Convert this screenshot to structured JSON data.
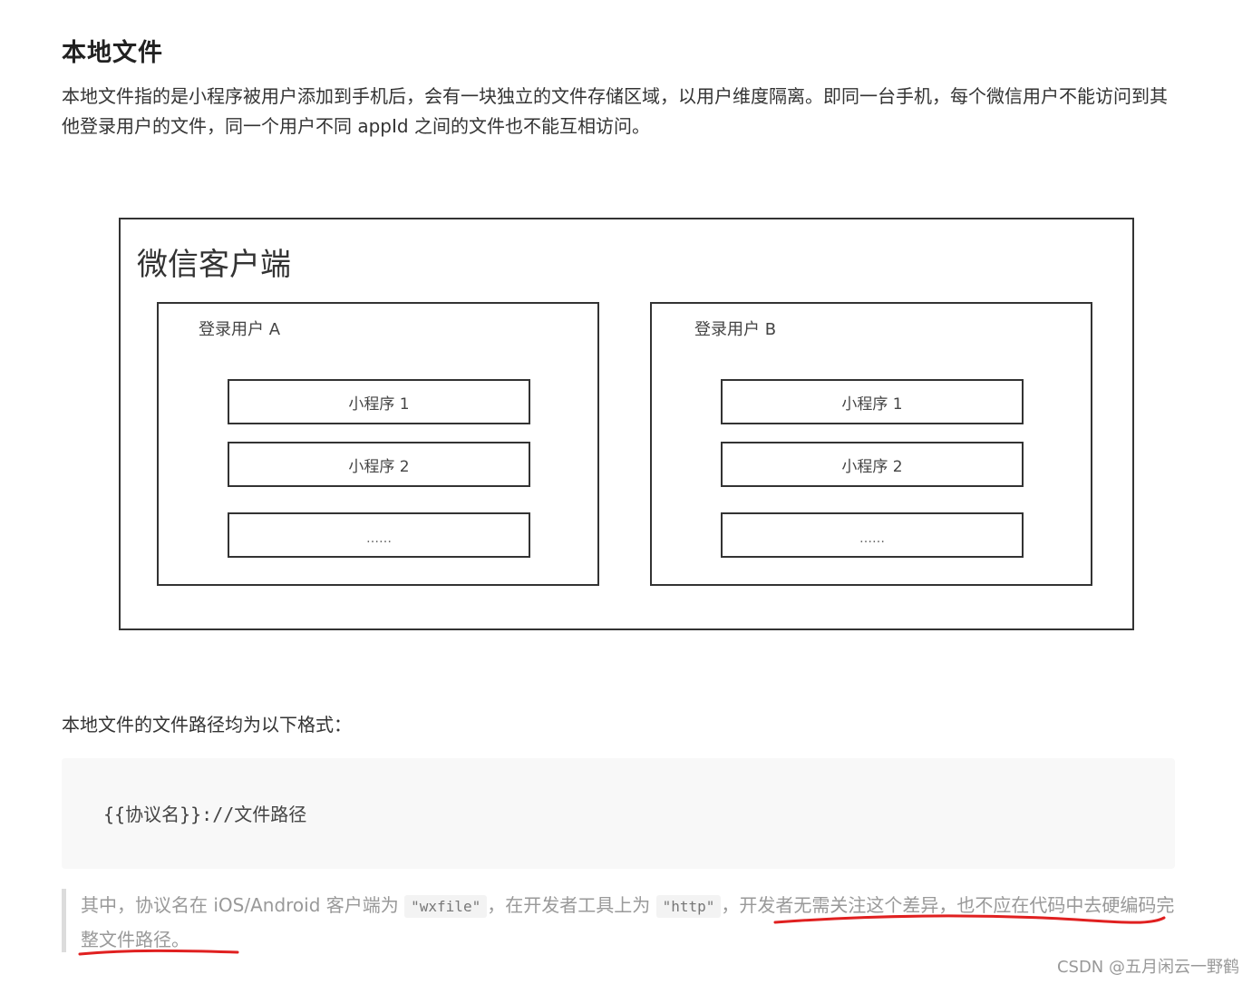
{
  "heading": "本地文件",
  "intro": "本地文件指的是小程序被用户添加到手机后，会有一块独立的文件存储区域，以用户维度隔离。即同一台手机，每个微信用户不能访问到其他登录用户的文件，同一个用户不同 appId 之间的文件也不能互相访问。",
  "diagram": {
    "outer_title": "微信客户端",
    "user_a": {
      "label": "登录用户 A",
      "programs": [
        "小程序 1",
        "小程序 2",
        "……"
      ]
    },
    "user_b": {
      "label": "登录用户 B",
      "programs": [
        "小程序 1",
        "小程序 2",
        "……"
      ]
    }
  },
  "path_intro": "本地文件的文件路径均为以下格式：",
  "code": "{{协议名}}://文件路径",
  "note": {
    "part1": "其中，协议名在 iOS/Android 客户端为 ",
    "code1": "\"wxfile\"",
    "part2": "，在开发者工具上为 ",
    "code2": "\"http\"",
    "part3": "，开发者无需关注这个差异，也不应在代码中去硬编码完整文件路径。",
    "annotation_color": "#e02020"
  },
  "watermark": "CSDN @五月闲云一野鹤"
}
